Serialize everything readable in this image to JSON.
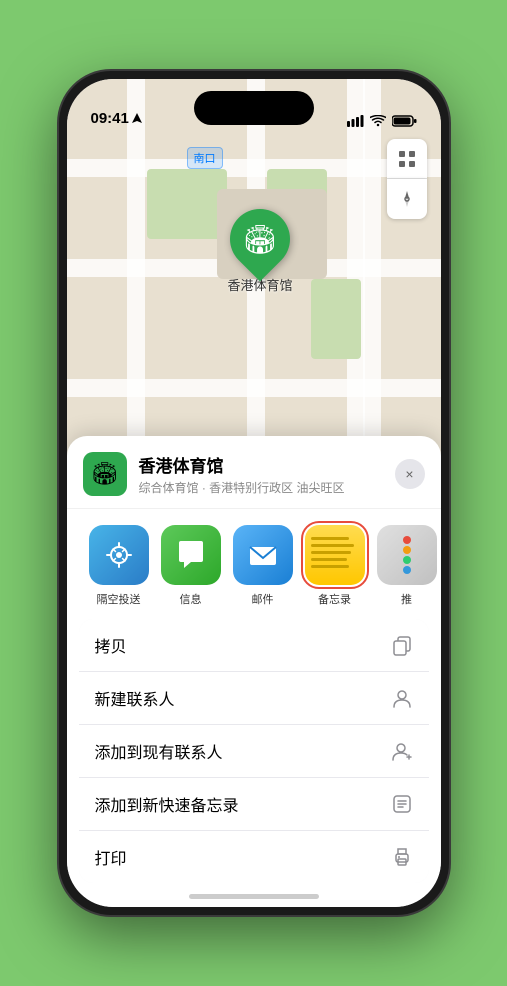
{
  "status_bar": {
    "time": "09:41",
    "location_icon": "▶"
  },
  "map": {
    "label": "南口",
    "marker_label": "香港体育馆"
  },
  "venue_card": {
    "name": "香港体育馆",
    "subtitle": "综合体育馆 · 香港特别行政区 油尖旺区",
    "close_label": "×"
  },
  "share_items": [
    {
      "id": "airdrop",
      "label": "隔空投送"
    },
    {
      "id": "messages",
      "label": "信息"
    },
    {
      "id": "mail",
      "label": "邮件"
    },
    {
      "id": "notes",
      "label": "备忘录"
    },
    {
      "id": "more",
      "label": "推"
    }
  ],
  "action_items": [
    {
      "id": "copy",
      "label": "拷贝",
      "icon": "⎘"
    },
    {
      "id": "new-contact",
      "label": "新建联系人",
      "icon": "👤"
    },
    {
      "id": "add-existing",
      "label": "添加到现有联系人",
      "icon": "👤"
    },
    {
      "id": "add-note",
      "label": "添加到新快速备忘录",
      "icon": "⊡"
    },
    {
      "id": "print",
      "label": "打印",
      "icon": "🖨"
    }
  ]
}
